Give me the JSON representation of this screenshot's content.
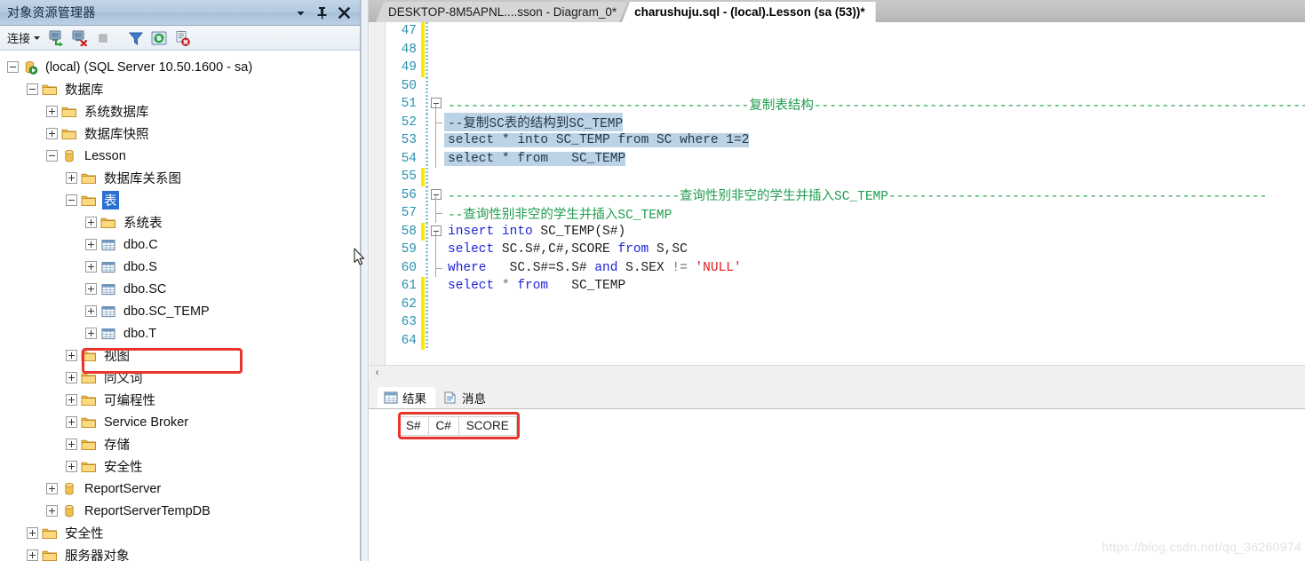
{
  "explorer": {
    "title": "对象资源管理器",
    "window_buttons": [
      {
        "name": "dropdown-icon",
        "glyph": "▼"
      },
      {
        "name": "pin-icon",
        "glyph": "⇩"
      },
      {
        "name": "close-icon",
        "glyph": "✕"
      }
    ],
    "toolbar": {
      "connect_label": "连接",
      "connect_caret": "▾",
      "buttons": [
        {
          "name": "connect-object-explorer-icon",
          "title": "连接"
        },
        {
          "name": "disconnect-object-explorer-icon",
          "title": "断开连接"
        },
        {
          "name": "stop-icon",
          "title": "停止"
        },
        {
          "name": "filter-icon",
          "title": "筛选器"
        },
        {
          "name": "refresh-icon",
          "title": "刷新"
        },
        {
          "name": "script-stop-icon",
          "title": "脚本"
        }
      ]
    },
    "tree": [
      {
        "label": "(local) (SQL Server 10.50.1600 - sa)",
        "depth": 0,
        "state": "minus",
        "icon": "server"
      },
      {
        "label": "数据库",
        "depth": 1,
        "state": "minus",
        "icon": "folder"
      },
      {
        "label": "系统数据库",
        "depth": 2,
        "state": "plus",
        "icon": "folder"
      },
      {
        "label": "数据库快照",
        "depth": 2,
        "state": "plus",
        "icon": "folder"
      },
      {
        "label": "Lesson",
        "depth": 2,
        "state": "minus",
        "icon": "database"
      },
      {
        "label": "数据库关系图",
        "depth": 3,
        "state": "plus",
        "icon": "folder"
      },
      {
        "label": "表",
        "depth": 3,
        "state": "minus",
        "icon": "folder",
        "selected": true
      },
      {
        "label": "系统表",
        "depth": 4,
        "state": "plus",
        "icon": "folder"
      },
      {
        "label": "dbo.C",
        "depth": 4,
        "state": "plus",
        "icon": "table"
      },
      {
        "label": "dbo.S",
        "depth": 4,
        "state": "plus",
        "icon": "table"
      },
      {
        "label": "dbo.SC",
        "depth": 4,
        "state": "plus",
        "icon": "table"
      },
      {
        "label": "dbo.SC_TEMP",
        "depth": 4,
        "state": "plus",
        "icon": "table",
        "highlighted": true
      },
      {
        "label": "dbo.T",
        "depth": 4,
        "state": "plus",
        "icon": "table"
      },
      {
        "label": "视图",
        "depth": 3,
        "state": "plus",
        "icon": "folder"
      },
      {
        "label": "同义词",
        "depth": 3,
        "state": "plus",
        "icon": "folder"
      },
      {
        "label": "可编程性",
        "depth": 3,
        "state": "plus",
        "icon": "folder"
      },
      {
        "label": "Service Broker",
        "depth": 3,
        "state": "plus",
        "icon": "folder"
      },
      {
        "label": "存储",
        "depth": 3,
        "state": "plus",
        "icon": "folder"
      },
      {
        "label": "安全性",
        "depth": 3,
        "state": "plus",
        "icon": "folder"
      },
      {
        "label": "ReportServer",
        "depth": 2,
        "state": "plus",
        "icon": "database"
      },
      {
        "label": "ReportServerTempDB",
        "depth": 2,
        "state": "plus",
        "icon": "database"
      },
      {
        "label": "安全性",
        "depth": 1,
        "state": "plus",
        "icon": "folder"
      },
      {
        "label": "服务器对象",
        "depth": 1,
        "state": "plus",
        "icon": "folder"
      }
    ]
  },
  "editor": {
    "tabs": [
      {
        "label": "DESKTOP-8M5APNL....sson - Diagram_0*",
        "active": false
      },
      {
        "label": "charushuju.sql - (local).Lesson (sa (53))*",
        "active": true
      }
    ],
    "lines": [
      {
        "no": "47",
        "changed": true,
        "fold": "none",
        "tokens": []
      },
      {
        "no": "48",
        "changed": true,
        "fold": "none",
        "tokens": []
      },
      {
        "no": "49",
        "changed": true,
        "fold": "none",
        "tokens": []
      },
      {
        "no": "50",
        "changed": false,
        "fold": "none",
        "tokens": []
      },
      {
        "no": "51",
        "changed": false,
        "fold": "box",
        "tokens": [
          {
            "t": "---------------------------------------复制表结构----------------------------------------------------------------",
            "c": "cm"
          }
        ]
      },
      {
        "no": "52",
        "changed": false,
        "fold": "endtick",
        "selected": true,
        "tokens": [
          {
            "t": "--复制SC表的结构到SC_TEMP",
            "c": "cm"
          }
        ]
      },
      {
        "no": "53",
        "changed": false,
        "fold": "line",
        "selected": true,
        "tokens": [
          {
            "t": "select",
            "c": "kw"
          },
          {
            "t": " * ",
            "c": "op"
          },
          {
            "t": "into",
            "c": "kw"
          },
          {
            "t": " SC_TEMP ",
            "c": "id"
          },
          {
            "t": "from",
            "c": "kw"
          },
          {
            "t": " SC ",
            "c": "id"
          },
          {
            "t": "where",
            "c": "kw"
          },
          {
            "t": " 1=2",
            "c": "id"
          }
        ]
      },
      {
        "no": "54",
        "changed": false,
        "fold": "line",
        "selected": true,
        "tokens": [
          {
            "t": "select",
            "c": "kw"
          },
          {
            "t": " * ",
            "c": "op"
          },
          {
            "t": "from",
            "c": "kw"
          },
          {
            "t": "   SC_TEMP",
            "c": "id"
          }
        ]
      },
      {
        "no": "55",
        "changed": true,
        "fold": "none",
        "tokens": []
      },
      {
        "no": "56",
        "changed": false,
        "fold": "box",
        "tokens": [
          {
            "t": "------------------------------查询性别非空的学生并插入SC_TEMP-------------------------------------------------",
            "c": "cm"
          }
        ]
      },
      {
        "no": "57",
        "changed": false,
        "fold": "endtick",
        "tokens": [
          {
            "t": "--查询性别非空的学生并插入",
            "c": "cm"
          },
          {
            "t": "SC_TEMP",
            "c": "cm"
          }
        ]
      },
      {
        "no": "58",
        "changed": true,
        "fold": "box",
        "tokens": [
          {
            "t": "insert",
            "c": "kw"
          },
          {
            "t": " ",
            "c": "id"
          },
          {
            "t": "into",
            "c": "kw"
          },
          {
            "t": " SC_TEMP(S#)",
            "c": "id"
          }
        ]
      },
      {
        "no": "59",
        "changed": false,
        "fold": "line",
        "tokens": [
          {
            "t": "select",
            "c": "kw"
          },
          {
            "t": " SC.S#,C#,SCORE ",
            "c": "id"
          },
          {
            "t": "from",
            "c": "kw"
          },
          {
            "t": " S,SC",
            "c": "id"
          }
        ]
      },
      {
        "no": "60",
        "changed": false,
        "fold": "endtick",
        "tokens": [
          {
            "t": "where",
            "c": "kw"
          },
          {
            "t": "   SC.S#=S.S# ",
            "c": "id"
          },
          {
            "t": "and",
            "c": "kw"
          },
          {
            "t": " S.SEX ",
            "c": "id"
          },
          {
            "t": "!=",
            "c": "op"
          },
          {
            "t": " ",
            "c": "id"
          },
          {
            "t": "'NULL'",
            "c": "st"
          }
        ]
      },
      {
        "no": "61",
        "changed": true,
        "fold": "none",
        "tokens": [
          {
            "t": "select",
            "c": "kw"
          },
          {
            "t": " * ",
            "c": "op"
          },
          {
            "t": "from",
            "c": "kw"
          },
          {
            "t": "   SC_TEMP",
            "c": "id"
          }
        ]
      },
      {
        "no": "62",
        "changed": true,
        "fold": "none",
        "tokens": []
      },
      {
        "no": "63",
        "changed": true,
        "fold": "none",
        "tokens": []
      },
      {
        "no": "64",
        "changed": true,
        "fold": "none",
        "tokens": []
      }
    ],
    "hscroll_left_arrow": "‹"
  },
  "results": {
    "tabs": [
      {
        "label": "结果",
        "icon": "grid-icon",
        "active": true
      },
      {
        "label": "消息",
        "icon": "messages-icon",
        "active": false
      }
    ],
    "columns": [
      "S#",
      "C#",
      "SCORE"
    ],
    "rows": []
  },
  "watermark": "https://blog.csdn.net/qq_36260974",
  "colors": {
    "comment_green": "#1f9d4d",
    "keyword_blue": "#1e24d8",
    "string_red": "#e01b1b",
    "line_number_teal": "#2b91af",
    "selection_blue": "#bcd3e6",
    "annotation_red": "#e8342a",
    "tree_selection": "#2a6fd1",
    "change_bar_yellow": "#ffe800"
  }
}
